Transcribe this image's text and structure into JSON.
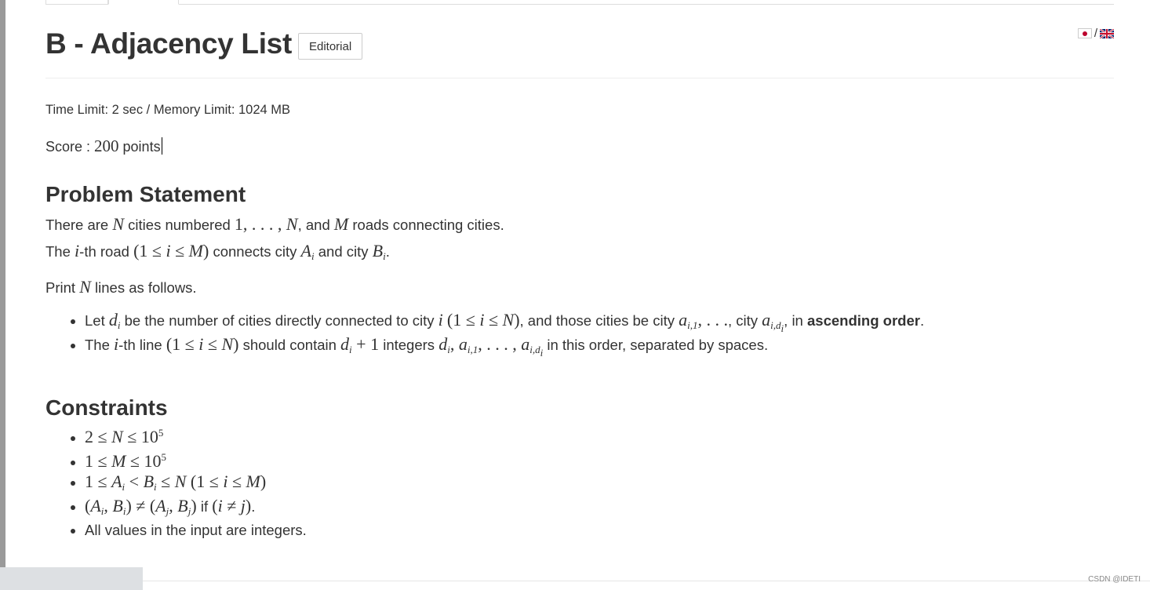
{
  "problem": {
    "title": "B - Adjacency List",
    "editorial_label": "Editorial",
    "lang_separator": "/",
    "limits": "Time Limit: 2 sec / Memory Limit: 1024 MB",
    "score_label": "Score : ",
    "score_value": "200",
    "score_unit": " points"
  },
  "statement": {
    "heading": "Problem Statement",
    "print_line": "Print N lines as follows."
  },
  "constraints": {
    "heading": "Constraints",
    "last_item": "All values in the input are integers."
  },
  "watermark": "CSDN @IDETI",
  "colors": {
    "text": "#333333",
    "flag_red": "#bc002d",
    "gb_blue": "#012169",
    "gb_red": "#c8102e"
  }
}
